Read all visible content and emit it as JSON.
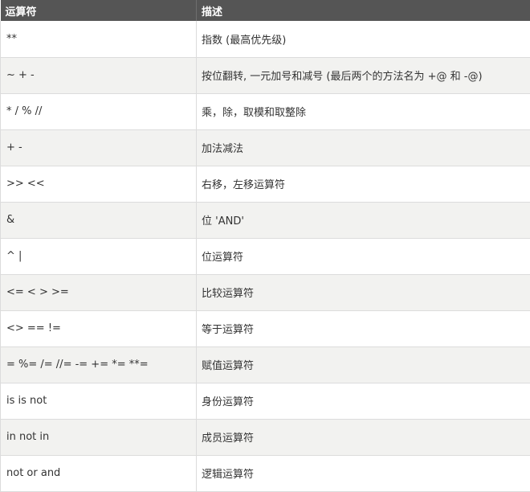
{
  "table": {
    "headers": [
      "运算符",
      "描述"
    ],
    "rows": [
      {
        "op": "**",
        "desc": "指数 (最高优先级)"
      },
      {
        "op": "~ + -",
        "desc": "按位翻转, 一元加号和减号 (最后两个的方法名为 +@ 和 -@)"
      },
      {
        "op": "* / % //",
        "desc": "乘，除，取模和取整除"
      },
      {
        "op": "+ -",
        "desc": "加法减法"
      },
      {
        "op": ">> <<",
        "desc": "右移，左移运算符"
      },
      {
        "op": "&",
        "desc": "位 'AND'"
      },
      {
        "op": "^ |",
        "desc": "位运算符"
      },
      {
        "op": "<= < > >=",
        "desc": "比较运算符"
      },
      {
        "op": "<> == !=",
        "desc": "等于运算符"
      },
      {
        "op": "= %= /= //= -= += *= **=",
        "desc": "赋值运算符"
      },
      {
        "op": "is is not",
        "desc": "身份运算符"
      },
      {
        "op": "in not in",
        "desc": "成员运算符"
      },
      {
        "op": "not or and",
        "desc": "逻辑运算符"
      }
    ]
  }
}
